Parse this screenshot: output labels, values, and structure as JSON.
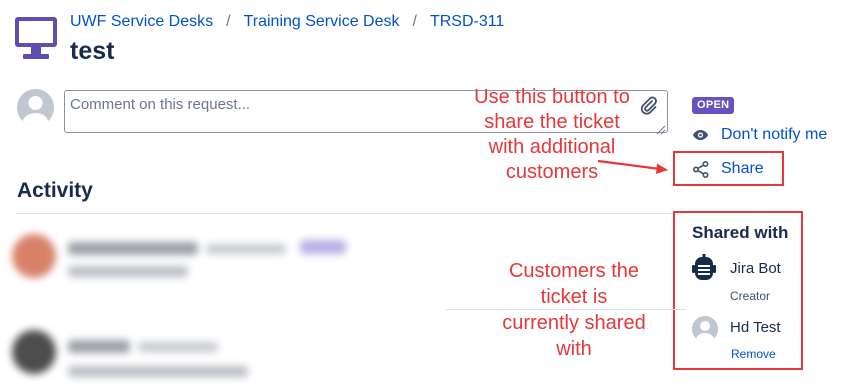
{
  "header": {
    "breadcrumb": [
      "UWF Service Desks",
      "Training Service Desk",
      "TRSD-311"
    ],
    "breadcrumb_separator": "/",
    "title": "test",
    "icon": "desktop-monitor-icon"
  },
  "comment": {
    "placeholder": "Comment on this request..."
  },
  "activity": {
    "title": "Activity"
  },
  "sidebar": {
    "status": "OPEN",
    "status_color": "#6554c0",
    "notify_label": "Don't notify me",
    "share_label": "Share",
    "shared_with_title": "Shared with",
    "participants": [
      {
        "name": "Jira Bot",
        "role": "Creator",
        "icon": "robot-icon"
      },
      {
        "name": "Hd Test",
        "action": "Remove",
        "icon": "default-avatar-icon"
      }
    ]
  },
  "annotations": {
    "share_note": [
      "Use this button to",
      "share the ticket",
      "with additional",
      "customers"
    ],
    "shared_note": [
      "Customers the",
      "ticket is",
      "currently shared",
      "with"
    ],
    "color": "#e5383b"
  },
  "colors": {
    "link": "#0052cc",
    "text": "#172b4d",
    "highlight": "#e5383b"
  }
}
